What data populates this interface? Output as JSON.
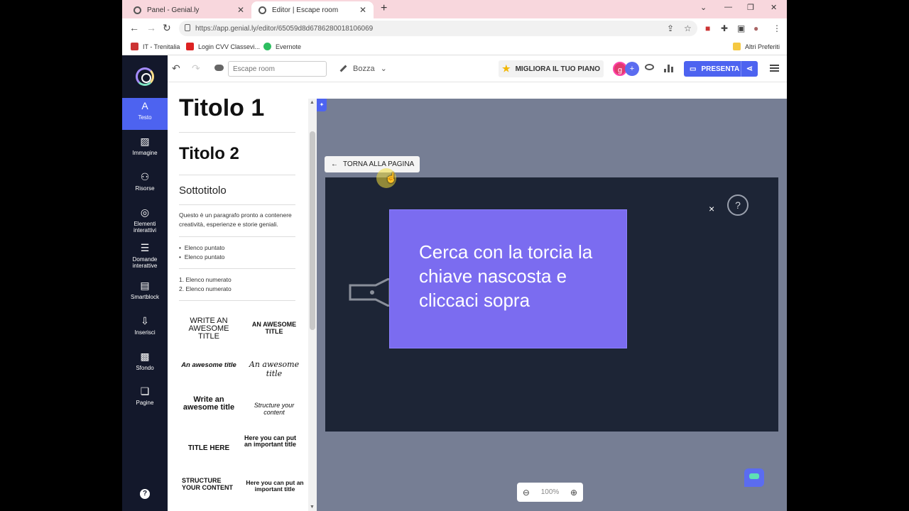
{
  "browser": {
    "tabs": [
      {
        "title": "Panel - Genial.ly",
        "active": false
      },
      {
        "title": "Editor | Escape room",
        "active": true
      }
    ],
    "url": "https://app.genial.ly/editor/65059d8d6786280018106069",
    "bookmarks": [
      "IT - Trenitalia",
      "Login CVV Classevi...",
      "Evernote"
    ],
    "other_bookmarks": "Altri Preferiti"
  },
  "toolbar": {
    "name_placeholder": "Escape room",
    "status": "Bozza",
    "upgrade_label": "MIGLIORA IL TUO PIANO",
    "present_label": "PRESENTA",
    "avatar_initial": "g"
  },
  "sidebar": {
    "items": [
      {
        "label": "Testo",
        "icon": "A"
      },
      {
        "label": "Immagine",
        "icon": "image"
      },
      {
        "label": "Risorse",
        "icon": "shapes"
      },
      {
        "label": "Elementi interattivi",
        "icon": "touch"
      },
      {
        "label": "Domande interattive",
        "icon": "checklist"
      },
      {
        "label": "Smartblock",
        "icon": "layout"
      },
      {
        "label": "Inserisci",
        "icon": "insert"
      },
      {
        "label": "Sfondo",
        "icon": "background"
      },
      {
        "label": "Pagine",
        "icon": "pages"
      }
    ],
    "help": "?"
  },
  "panel": {
    "title1": "Titolo 1",
    "title2": "Titolo 2",
    "subtitle": "Sottotitolo",
    "paragraph": "Questo è un paragrafo pronto a contenere creatività, esperienze e storie geniali.",
    "bullets": [
      "Elenco puntato",
      "Elenco puntato"
    ],
    "numbered": [
      "1. Elenco numerato",
      "2. Elenco numerato"
    ],
    "styles": [
      "WRITE AN AWESOME TITLE",
      "AN AWESOME TITLE",
      "An awesome title",
      "An awesome title",
      "Write an awesome title",
      "Structure your content",
      "TITLE HERE",
      "Here you can put an important title",
      "STRUCTURE YOUR CONTENT",
      "Here you can put an important title"
    ]
  },
  "canvas": {
    "back_label": "TORNA ALLA PAGINA",
    "close": "×",
    "help": "?",
    "popup_text": "Cerca con la torcia la chiave nascosta e cliccaci sopra",
    "zoom": "100%"
  }
}
